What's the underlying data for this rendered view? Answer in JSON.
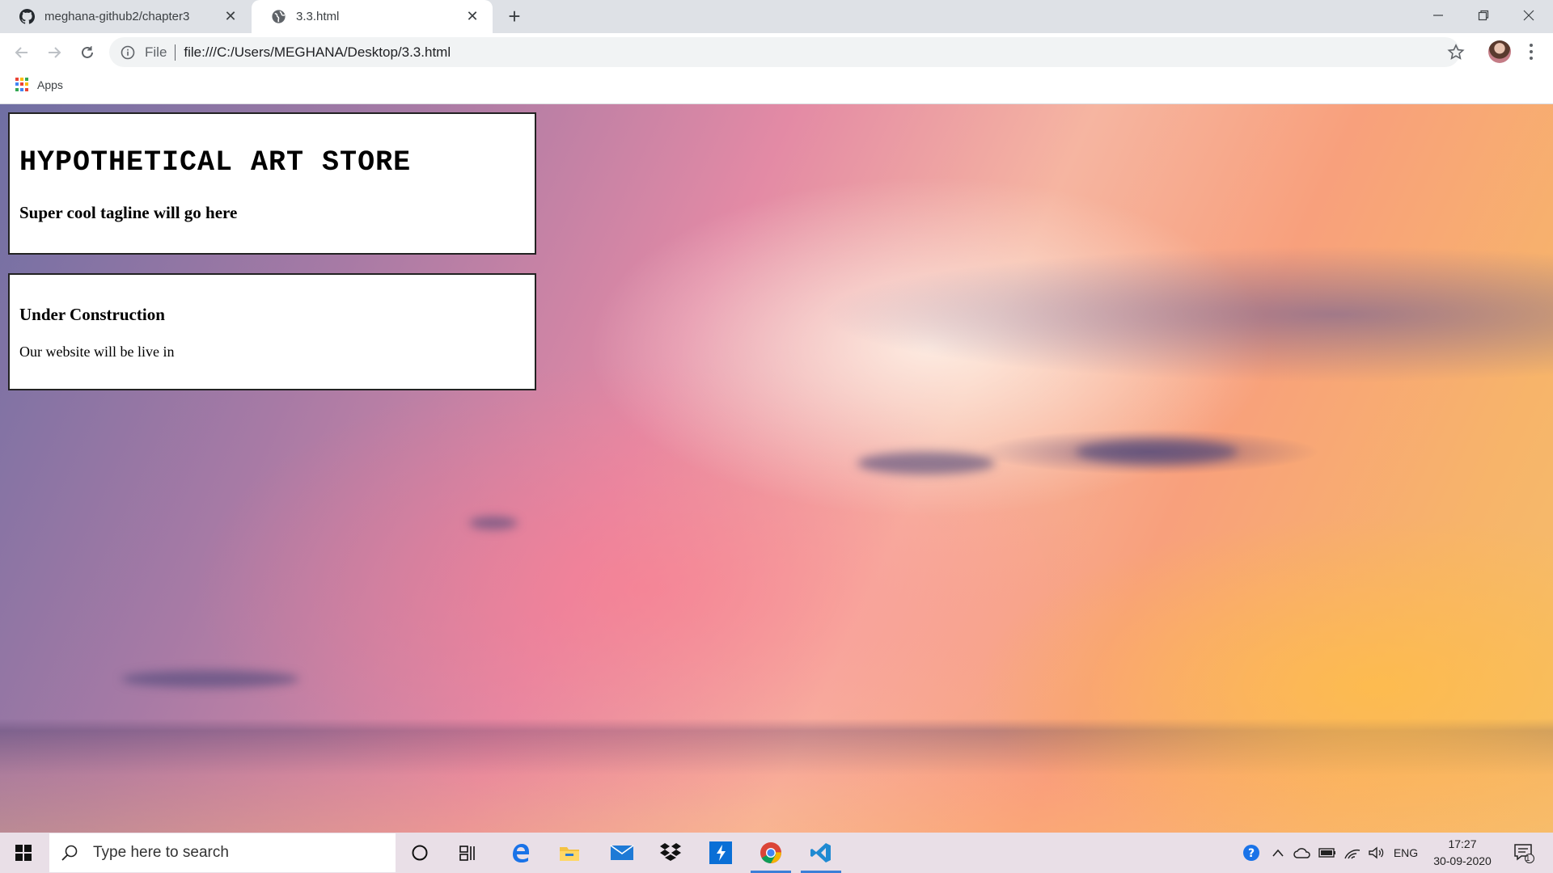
{
  "browser": {
    "tabs": [
      {
        "label": "meghana-github2/chapter3",
        "icon": "github-icon",
        "active": false
      },
      {
        "label": "3.3.html",
        "icon": "globe-icon",
        "active": true
      }
    ],
    "address": {
      "scheme_label": "File",
      "url": "file:///C:/Users/MEGHANA/Desktop/3.3.html"
    },
    "bookmarks": [
      {
        "label": "Apps",
        "icon": "apps-grid-icon"
      }
    ]
  },
  "page": {
    "header": {
      "title": "HYPOTHETICAL ART STORE",
      "tagline": "Super cool tagline will go here"
    },
    "notice": {
      "title": "Under Construction",
      "text": "Our website will be live in"
    }
  },
  "taskbar": {
    "search_placeholder": "Type here to search",
    "pinned": [
      "cortana-icon",
      "task-view-icon",
      "edge-icon",
      "file-explorer-icon",
      "mail-icon",
      "dropbox-icon",
      "powerautomate-icon",
      "chrome-icon",
      "vscode-icon"
    ],
    "tray": {
      "language": "ENG",
      "time": "17:27",
      "date": "30-09-2020",
      "notifications": "1"
    }
  },
  "colors": {
    "tab_strip": "#dee1e6",
    "taskbar": "#e9dfe7",
    "accent": "#3c7fd8"
  }
}
